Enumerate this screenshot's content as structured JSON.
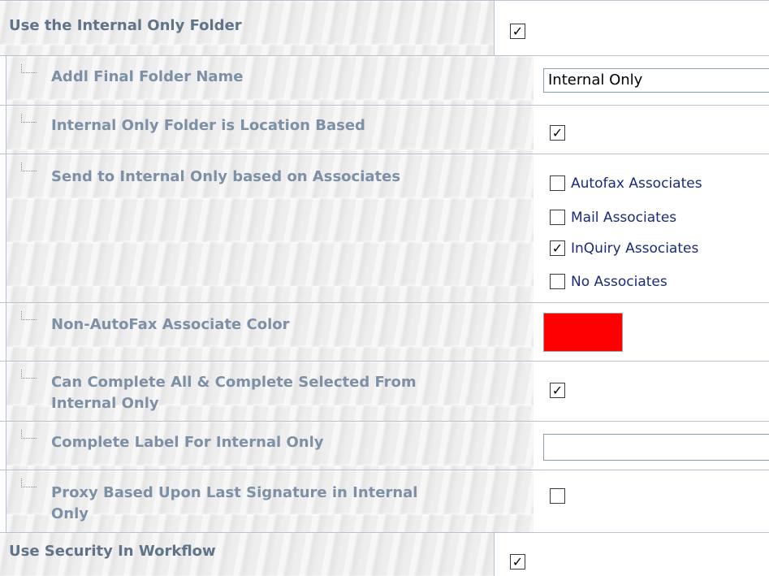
{
  "rows": [
    {
      "label": "Use the Internal Only Folder",
      "checked": "✓"
    },
    {
      "label": "Addl Final Folder Name",
      "value": "Internal Only"
    },
    {
      "label": "Internal Only Folder is Location Based",
      "checked": "✓"
    },
    {
      "label": "Send to Internal Only based on Associates",
      "options": [
        {
          "label": "Autofax Associates",
          "checked": ""
        },
        {
          "label": "Mail Associates",
          "checked": ""
        },
        {
          "label": "InQuiry Associates",
          "checked": "✓"
        },
        {
          "label": "No Associates",
          "checked": ""
        }
      ]
    },
    {
      "label": "Non-AutoFax Associate Color",
      "color": "#ff0000"
    },
    {
      "label_line1": "Can Complete All & Complete Selected From",
      "label_line2": "Internal Only",
      "checked": "✓"
    },
    {
      "label": "Complete Label For Internal Only",
      "value": ""
    },
    {
      "label_line1": "Proxy Based Upon Last Signature in Internal",
      "label_line2": "Only",
      "checked": ""
    },
    {
      "label": "Use Security In Workflow",
      "checked": "✓"
    }
  ]
}
